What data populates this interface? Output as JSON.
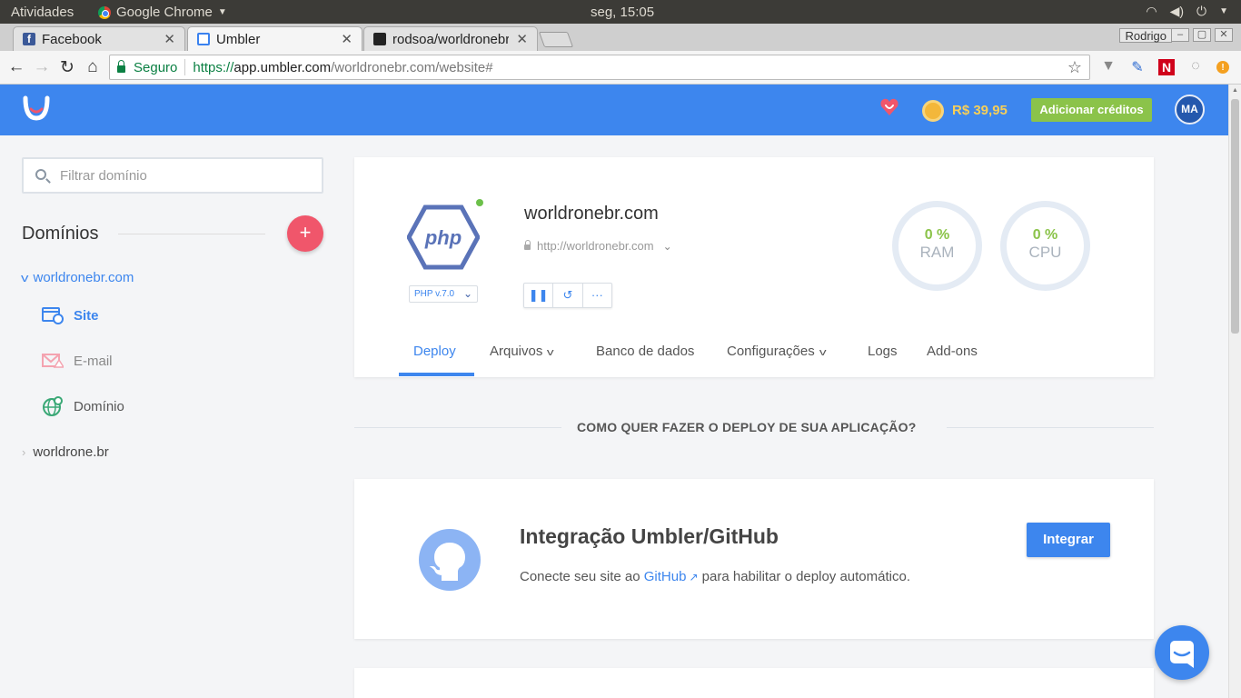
{
  "os": {
    "activities": "Atividades",
    "app_name": "Google Chrome",
    "clock": "seg, 15:05"
  },
  "browser": {
    "tabs": [
      {
        "label": "Facebook",
        "icon": "facebook-icon"
      },
      {
        "label": "Umbler",
        "icon": "umbler-icon"
      },
      {
        "label": "rodsoa/worldronebr",
        "icon": "github-icon"
      }
    ],
    "profile": "Rodrigo",
    "secure_label": "Seguro",
    "url": {
      "scheme": "https://",
      "host": "app.umbler.com",
      "path": "/worldronebr.com/website#"
    }
  },
  "header": {
    "credit": "R$ 39,95",
    "add_credit": "Adicionar créditos",
    "avatar": "MA",
    "colors": {
      "brand": "#3d86ee",
      "credit": "#f6cf59",
      "button": "#8bc34a"
    }
  },
  "sidebar": {
    "filter_placeholder": "Filtrar domínio",
    "title": "Domínios",
    "domains": [
      {
        "name": "worldronebr.com",
        "expanded": true
      },
      {
        "name": "worldrone.br",
        "expanded": false
      }
    ],
    "sub_items": [
      {
        "label": "Site",
        "icon": "site-icon",
        "active": true
      },
      {
        "label": "E-mail",
        "icon": "email-icon",
        "active": false
      },
      {
        "label": "Domínio",
        "icon": "globe-icon",
        "active": false
      }
    ]
  },
  "site": {
    "logo_text": "php",
    "php_version": "PHP v.7.0",
    "name": "worldronebr.com",
    "url": "http://worldronebr.com",
    "ram": {
      "value": "0 %",
      "label": "RAM"
    },
    "cpu": {
      "value": "0 %",
      "label": "CPU"
    },
    "more_label": "···"
  },
  "tabs": [
    {
      "label": "Deploy",
      "active": true,
      "dropdown": false
    },
    {
      "label": "Arquivos",
      "active": false,
      "dropdown": true
    },
    {
      "label": "Banco de dados",
      "active": false,
      "dropdown": false
    },
    {
      "label": "Configurações",
      "active": false,
      "dropdown": true
    },
    {
      "label": "Logs",
      "active": false,
      "dropdown": false
    },
    {
      "label": "Add-ons",
      "active": false,
      "dropdown": false
    }
  ],
  "deploy": {
    "section_title": "COMO QUER FAZER O DEPLOY DE SUA APLICAÇÃO?",
    "github": {
      "title": "Integração Umbler/GitHub",
      "desc_before": "Conecte seu site ao ",
      "link": "GitHub",
      "desc_after": " para habilitar o deploy automático.",
      "button": "Integrar"
    }
  }
}
